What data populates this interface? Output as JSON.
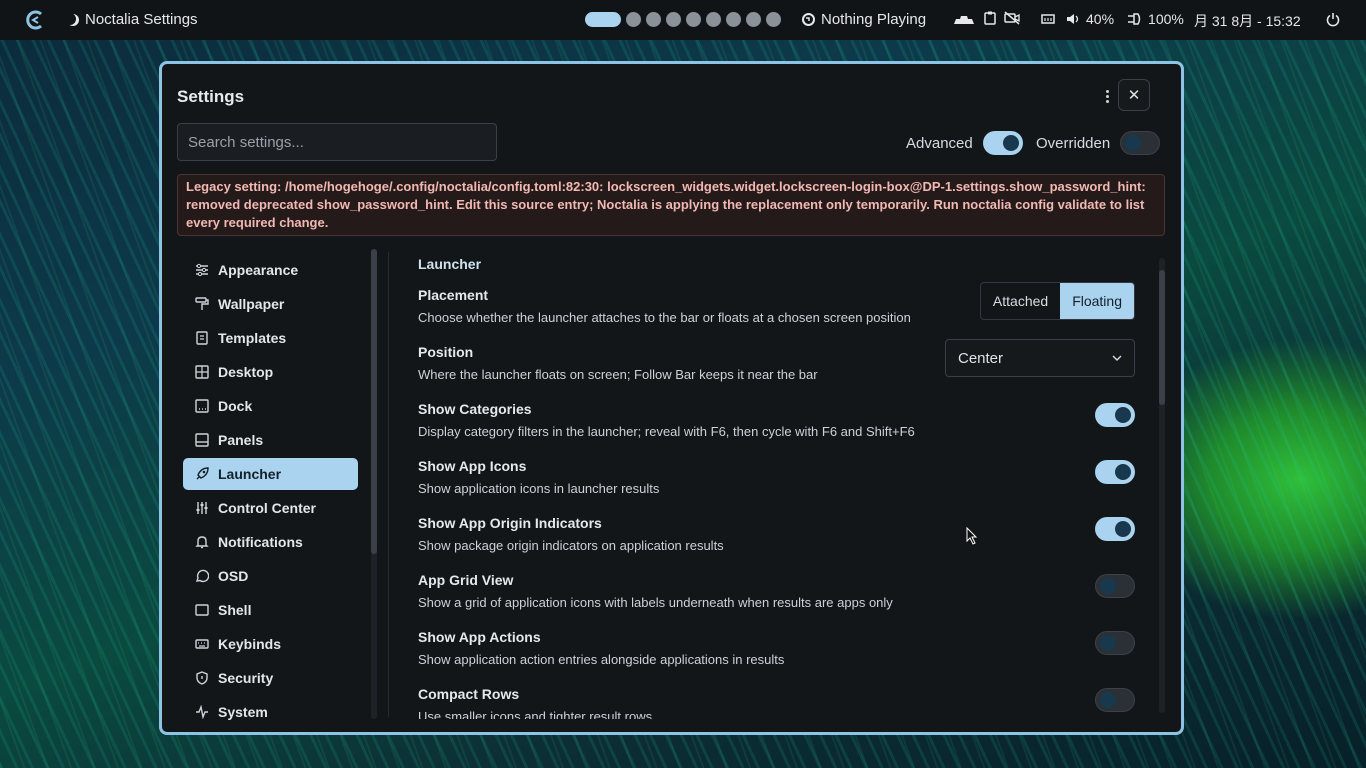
{
  "topbar": {
    "app_name": "Noctalia Settings",
    "media": "Nothing Playing",
    "volume": "40%",
    "battery": "100%",
    "clock": "月 31 8月 - 15:32",
    "workspaces_count": 9,
    "active_workspace": 1
  },
  "window": {
    "title": "Settings",
    "search_placeholder": "Search settings...",
    "advanced_label": "Advanced",
    "advanced_on": true,
    "overridden_label": "Overridden",
    "overridden_on": false,
    "legacy_warning": "Legacy setting: /home/hogehoge/.config/noctalia/config.toml:82:30: lockscreen_widgets.widget.lockscreen-login-box@DP-1.settings.show_password_hint: removed deprecated show_password_hint. Edit this source entry; Noctalia is applying the replacement only temporarily. Run noctalia config validate to list every required change."
  },
  "sidebar": {
    "items": [
      {
        "label": "Appearance",
        "icon": "sliders-icon"
      },
      {
        "label": "Wallpaper",
        "icon": "paint-roller-icon"
      },
      {
        "label": "Templates",
        "icon": "templates-icon"
      },
      {
        "label": "Desktop",
        "icon": "desktop-grid-icon"
      },
      {
        "label": "Dock",
        "icon": "dock-icon"
      },
      {
        "label": "Panels",
        "icon": "panels-icon"
      },
      {
        "label": "Launcher",
        "icon": "rocket-icon",
        "active": true
      },
      {
        "label": "Control Center",
        "icon": "control-sliders-icon"
      },
      {
        "label": "Notifications",
        "icon": "bell-icon"
      },
      {
        "label": "OSD",
        "icon": "message-circle-icon"
      },
      {
        "label": "Shell",
        "icon": "terminal-window-icon"
      },
      {
        "label": "Keybinds",
        "icon": "keyboard-icon"
      },
      {
        "label": "Security",
        "icon": "shield-icon"
      },
      {
        "label": "System",
        "icon": "activity-icon"
      }
    ]
  },
  "content": {
    "section_title": "Launcher",
    "placement": {
      "label": "Placement",
      "desc": "Choose whether the launcher attaches to the bar or floats at a chosen screen position",
      "options": [
        "Attached",
        "Floating"
      ],
      "selected": "Floating"
    },
    "position": {
      "label": "Position",
      "desc": "Where the launcher floats on screen; Follow Bar keeps it near the bar",
      "value": "Center"
    },
    "toggles": [
      {
        "label": "Show Categories",
        "desc": "Display category filters in the launcher; reveal with F6, then cycle with F6 and Shift+F6",
        "on": true
      },
      {
        "label": "Show App Icons",
        "desc": "Show application icons in launcher results",
        "on": true
      },
      {
        "label": "Show App Origin Indicators",
        "desc": "Show package origin indicators on application results",
        "on": true
      },
      {
        "label": "App Grid View",
        "desc": "Show a grid of application icons with labels underneath when results are apps only",
        "on": false
      },
      {
        "label": "Show App Actions",
        "desc": "Show application action entries alongside applications in results",
        "on": false
      },
      {
        "label": "Compact Rows",
        "desc": "Use smaller icons and tighter result rows",
        "on": false
      }
    ]
  }
}
